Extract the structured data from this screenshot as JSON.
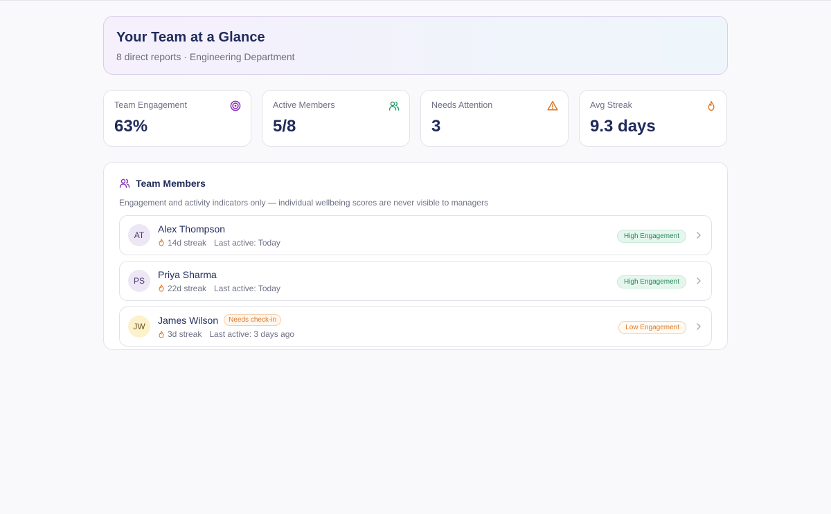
{
  "hero": {
    "title": "Your Team at a Glance",
    "subtitle": "8 direct reports · Engineering Department"
  },
  "stats": [
    {
      "label": "Team Engagement",
      "value": "63%",
      "icon": "target-icon",
      "color": "#8b2fb8"
    },
    {
      "label": "Active Members",
      "value": "5/8",
      "icon": "users-icon",
      "color": "#1f9d6b"
    },
    {
      "label": "Needs Attention",
      "value": "3",
      "icon": "warning-icon",
      "color": "#d9782a"
    },
    {
      "label": "Avg Streak",
      "value": "9.3 days",
      "icon": "flame-icon",
      "color": "#e07a2c"
    }
  ],
  "members_panel": {
    "title": "Team Members",
    "note": "Engagement and activity indicators only — individual wellbeing scores are never visible to managers",
    "rows": [
      {
        "initials": "AT",
        "name": "Alex Thompson",
        "streak": "14d streak",
        "last_active": "Last active: Today",
        "badge": "High Engagement",
        "tag": ""
      },
      {
        "initials": "PS",
        "name": "Priya Sharma",
        "streak": "22d streak",
        "last_active": "Last active: Today",
        "badge": "High Engagement",
        "tag": ""
      },
      {
        "initials": "JW",
        "name": "James Wilson",
        "streak": "3d streak",
        "last_active": "Last active: 3 days ago",
        "badge": "Low Engagement",
        "tag": "Needs check-in"
      }
    ]
  }
}
